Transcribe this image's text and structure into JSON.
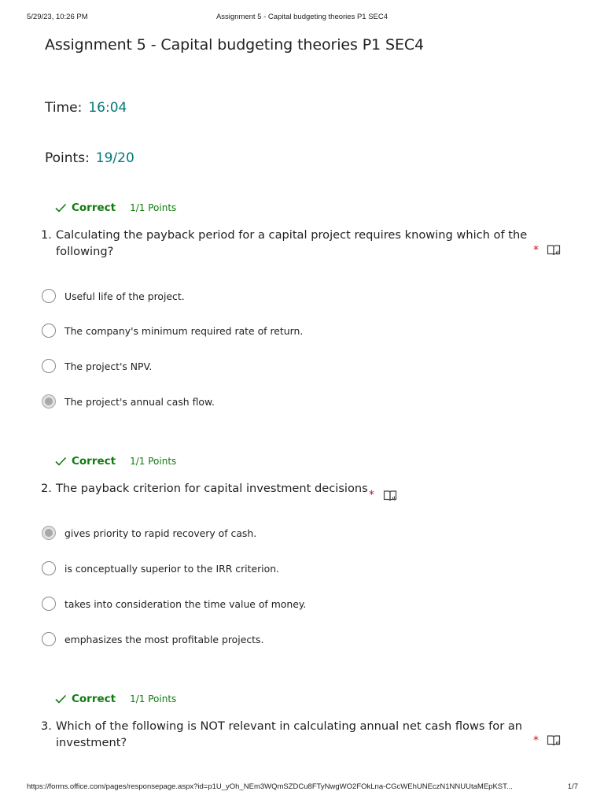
{
  "print_header": {
    "datetime": "5/29/23, 10:26 PM",
    "title": "Assignment 5 - Capital budgeting theories P1 SEC4"
  },
  "form": {
    "title": "Assignment 5 - Capital budgeting theories P1 SEC4",
    "time_label": "Time:",
    "time_value": "16:04",
    "points_label": "Points:",
    "points_value": "19/20"
  },
  "questions": [
    {
      "result_label": "Correct",
      "points": "1/1 Points",
      "number": "1.",
      "text_line1": "Calculating the payback period for a capital project requires knowing which of the",
      "text_line2": "following?",
      "required_mark": "*",
      "selected_index": 3,
      "options": [
        "Useful life of the project.",
        "The company's minimum required rate of return.",
        "The project's NPV.",
        "The project's annual cash flow."
      ]
    },
    {
      "result_label": "Correct",
      "points": "1/1 Points",
      "number": "2.",
      "text_line1": "The payback criterion for capital investment decisions",
      "required_mark": "*",
      "selected_index": 0,
      "options": [
        "gives priority to rapid recovery of cash.",
        "is conceptually superior to the IRR criterion.",
        "takes into consideration the time value of money.",
        "emphasizes the most profitable projects."
      ]
    },
    {
      "result_label": "Correct",
      "points": "1/1 Points",
      "number": "3.",
      "text_line1": "Which of the following is NOT relevant in calculating annual net cash flows for an",
      "text_line2": "investment?",
      "required_mark": "*"
    }
  ],
  "icons": {
    "result": "checkmark-icon",
    "reader": "immersive-reader-icon",
    "accent_color": "#03787c",
    "correct_color": "#107c10",
    "required_color": "#c50f1f"
  },
  "print_footer": {
    "url": "https://forms.office.com/pages/responsepage.aspx?id=p1U_yOh_NEm3WQmSZDCu8FTyNwgWO2FOkLna-CGcWEhUNEczN1NNUUtaMEpKST...",
    "page": "1/7"
  }
}
